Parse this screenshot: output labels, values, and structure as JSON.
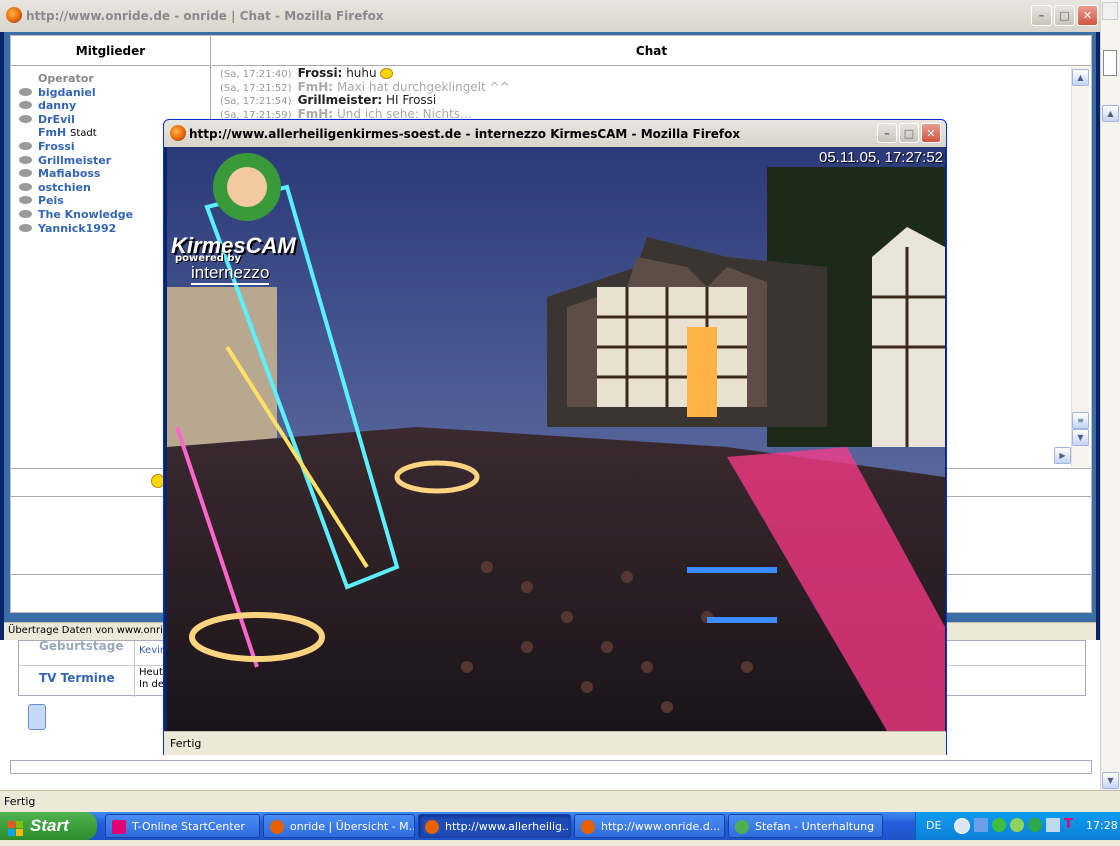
{
  "background": {
    "status_text": "Fertig",
    "lower_rows": [
      {
        "label": "Geburtstage",
        "text": "Kevin"
      },
      {
        "label": "TV Termine",
        "text": "Heut\nIn de"
      }
    ]
  },
  "chat_window": {
    "title": "http://www.onride.de - onride | Chat - Mozilla Firefox",
    "members_header": "Mitglieder",
    "chat_header": "Chat",
    "members": [
      {
        "name": "Operator",
        "operator": true,
        "city": ""
      },
      {
        "name": "bigdaniel",
        "operator": false,
        "city": ""
      },
      {
        "name": "danny",
        "operator": false,
        "city": ""
      },
      {
        "name": "DrEvil",
        "operator": false,
        "city": ""
      },
      {
        "name": "FmH",
        "operator": true,
        "city": "Stadt"
      },
      {
        "name": "Frossi",
        "operator": false,
        "city": ""
      },
      {
        "name": "Grillmeister",
        "operator": false,
        "city": ""
      },
      {
        "name": "Mafiaboss",
        "operator": false,
        "city": ""
      },
      {
        "name": "ostchien",
        "operator": false,
        "city": ""
      },
      {
        "name": "Peis",
        "operator": false,
        "city": ""
      },
      {
        "name": "The Knowledge",
        "operator": false,
        "city": ""
      },
      {
        "name": "Yannick1992",
        "operator": false,
        "city": ""
      }
    ],
    "messages": [
      {
        "time": "(Sa, 17:21:40)",
        "user": "Frossi:",
        "text": "huhu",
        "dim": false
      },
      {
        "time": "(Sa, 17:21:52)",
        "user": "FmH:",
        "text": "Maxi hat durchgeklingelt ^^",
        "dim": true
      },
      {
        "time": "(Sa, 17:21:54)",
        "user": "Grillmeister:",
        "text": "HI Frossi",
        "dim": false
      },
      {
        "time": "(Sa, 17:21:59)",
        "user": "FmH:",
        "text": "Und ich sehe: Nichts...",
        "dim": true
      }
    ],
    "status_text": "Übertrage Daten von www.onride"
  },
  "kirmes_window": {
    "title": "http://www.allerheiligenkirmes-soest.de - internezzo KirmesCAM - Mozilla Firefox",
    "timestamp": "05.11.05,  17:27:52",
    "logo": "KirmesCAM",
    "powered_by": "powered by",
    "brand": "internezzo",
    "status_text": "Fertig"
  },
  "taskbar": {
    "start_label": "Start",
    "tasks": [
      {
        "label": "T-Online StartCenter",
        "icon_color": "#e20074",
        "pressed": false
      },
      {
        "label": "onride | Übersicht - M...",
        "icon_color": "#e66000",
        "pressed": false
      },
      {
        "label": "http://www.allerheilig...",
        "icon_color": "#e66000",
        "pressed": true
      },
      {
        "label": "http://www.onride.d...",
        "icon_color": "#e66000",
        "pressed": false
      },
      {
        "label": "Stefan - Unterhaltung",
        "icon_color": "#4caf50",
        "pressed": false
      }
    ],
    "language": "DE",
    "clock": "17:28"
  }
}
